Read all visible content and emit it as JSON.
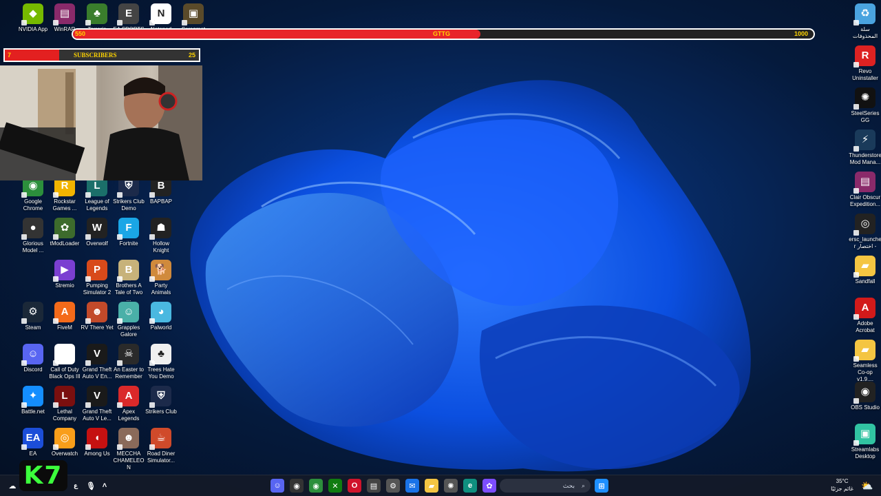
{
  "overlay": {
    "goal": {
      "left": "550",
      "center": "GTTG",
      "right": "1000",
      "fill_fraction": 0.55
    },
    "subs": {
      "left": "7",
      "label": "SUBSCRIBERS",
      "right": "25",
      "fill_fraction": 0.28
    },
    "logo_text": "K7"
  },
  "desktop_left": [
    {
      "label": "NVIDIA App",
      "icon": "nvidia-icon",
      "color": "#76b900",
      "glyph": "◆"
    },
    {
      "label": "WinRAR",
      "icon": "winrar-icon",
      "color": "#8a2a6a",
      "glyph": "▤"
    },
    {
      "label": "Terraria",
      "icon": "terraria-icon",
      "color": "#3a7d2c",
      "glyph": "♣"
    },
    {
      "label": "EA SPORTS",
      "icon": "ea-sports-icon",
      "color": "#444",
      "glyph": "E"
    },
    {
      "label": "Notepad",
      "icon": "notion-icon",
      "color": "#ffffff",
      "glyph": "N"
    },
    {
      "label": "Scrapmat",
      "icon": "scrap-icon",
      "color": "#5a4a2a",
      "glyph": "▣"
    },
    {
      "label": "Google Chrome",
      "icon": "chrome-icon",
      "color": "#2c8f3c",
      "glyph": "◉"
    },
    {
      "label": "Rockstar Games ...",
      "icon": "rockstar-icon",
      "color": "#f2b400",
      "glyph": "R"
    },
    {
      "label": "League of Legends",
      "icon": "league-icon",
      "color": "#1b6f6a",
      "glyph": "L"
    },
    {
      "label": "Strikers Club Demo",
      "icon": "strikers-icon",
      "color": "#1c2a4a",
      "glyph": "⛨"
    },
    {
      "label": "BAPBAP",
      "icon": "bapbap-icon",
      "color": "#222",
      "glyph": "B"
    },
    {
      "label": "Glorious Model ...",
      "icon": "mouse-icon",
      "color": "#333",
      "glyph": "●"
    },
    {
      "label": "tModLoader",
      "icon": "tmodloader-icon",
      "color": "#3d6b2c",
      "glyph": "✿"
    },
    {
      "label": "Overwolf",
      "icon": "overwolf-icon",
      "color": "#222",
      "glyph": "W"
    },
    {
      "label": "Fortnite",
      "icon": "fortnite-icon",
      "color": "#1aa6e6",
      "glyph": "F"
    },
    {
      "label": "Hollow Knight",
      "icon": "hollow-knight-icon",
      "color": "#222",
      "glyph": "☗"
    },
    {
      "label": "Stremio",
      "icon": "stremio-icon",
      "color": "#7b3fd1",
      "glyph": "▶"
    },
    {
      "label": "Pumping Simulator 2",
      "icon": "pumping-icon",
      "color": "#d84a1a",
      "glyph": "P"
    },
    {
      "label": "Brothers A Tale of Two ...",
      "icon": "brothers-icon",
      "color": "#c7b27a",
      "glyph": "B"
    },
    {
      "label": "Party Animals",
      "icon": "party-animals-icon",
      "color": "#d08a3c",
      "glyph": "🐕"
    },
    {
      "label": "Steam",
      "icon": "steam-icon",
      "color": "#1b2838",
      "glyph": "⚙"
    },
    {
      "label": "FiveM",
      "icon": "fivem-icon",
      "color": "#f46a1a",
      "glyph": "A"
    },
    {
      "label": "RV There Yet",
      "icon": "rv-icon",
      "color": "#c24a2a",
      "glyph": "☻"
    },
    {
      "label": "Grapples Galore",
      "icon": "grapples-icon",
      "color": "#4ab0a8",
      "glyph": "☺"
    },
    {
      "label": "Palworld",
      "icon": "palworld-icon",
      "color": "#4ab8e0",
      "glyph": "◕"
    },
    {
      "label": "Discord",
      "icon": "discord-icon",
      "color": "#5865f2",
      "glyph": "☺"
    },
    {
      "label": "Call of Duty Black Ops III",
      "icon": "file-icon",
      "color": "#ffffff",
      "glyph": " "
    },
    {
      "label": "Grand Theft Auto V En...",
      "icon": "gta-icon",
      "color": "#1a1a1a",
      "glyph": "V"
    },
    {
      "label": "An Easter to Remember",
      "icon": "easter-icon",
      "color": "#2a2a2a",
      "glyph": "☠"
    },
    {
      "label": "Trees Hate You Demo",
      "icon": "trees-icon",
      "color": "#f0f0f0",
      "glyph": "♣"
    },
    {
      "label": "Battle.net",
      "icon": "battlenet-icon",
      "color": "#148eff",
      "glyph": "✦"
    },
    {
      "label": "Lethal Company",
      "icon": "lethal-icon",
      "color": "#7a0f0f",
      "glyph": "L"
    },
    {
      "label": "Grand Theft Auto V Le...",
      "icon": "gta-icon",
      "color": "#1a1a1a",
      "glyph": "V"
    },
    {
      "label": "Apex Legends",
      "icon": "apex-icon",
      "color": "#da292a",
      "glyph": "A"
    },
    {
      "label": "Strikers Club",
      "icon": "strikers-icon",
      "color": "#1c2a4a",
      "glyph": "⛨"
    },
    {
      "label": "EA",
      "icon": "ea-icon",
      "color": "#1c4ed8",
      "glyph": "EA"
    },
    {
      "label": "Overwatch",
      "icon": "overwatch-icon",
      "color": "#f99e1a",
      "glyph": "◎"
    },
    {
      "label": "Among Us",
      "icon": "among-us-icon",
      "color": "#c51111",
      "glyph": "◖"
    },
    {
      "label": "MECCHA CHAMELEON",
      "icon": "meccha-icon",
      "color": "#8a6a5a",
      "glyph": "☻"
    },
    {
      "label": "Road Diner Simulator...",
      "icon": "road-diner-icon",
      "color": "#d04a2a",
      "glyph": "☕"
    }
  ],
  "desktop_right": [
    {
      "label": "سلة المحذوفات",
      "icon": "recycle-bin-icon",
      "color": "#4aa3df",
      "glyph": "♻"
    },
    {
      "label": "Revo Uninstaller",
      "icon": "revo-icon",
      "color": "#d22",
      "glyph": "R"
    },
    {
      "label": "SteelSeries GG",
      "icon": "steelseries-icon",
      "color": "#111",
      "glyph": "✺"
    },
    {
      "label": "Thunderstore Mod Mana...",
      "icon": "thunderstore-icon",
      "color": "#1a3a5a",
      "glyph": "⚡"
    },
    {
      "label": "Clair Obscur Expedition...",
      "icon": "winrar-icon",
      "color": "#8a2a6a",
      "glyph": "▤"
    },
    {
      "label": "ersc_launcher اختصار -",
      "icon": "ersc-icon",
      "color": "#222",
      "glyph": "◎"
    },
    {
      "label": "Sandfall",
      "icon": "folder-icon",
      "color": "#f4c542",
      "glyph": "▰"
    },
    {
      "label": "Adobe Acrobat",
      "icon": "acrobat-icon",
      "color": "#d21a1a",
      "glyph": "A"
    },
    {
      "label": "Seamless Co-op v1.9....",
      "icon": "folder-icon",
      "color": "#f4c542",
      "glyph": "▰"
    },
    {
      "label": "OBS Studio",
      "icon": "obs-icon",
      "color": "#222",
      "glyph": "◉"
    },
    {
      "label": "Streamlabs Desktop",
      "icon": "streamlabs-icon",
      "color": "#31c3a2",
      "glyph": "▣"
    }
  ],
  "taskbar": {
    "search_text": "بحث",
    "weather": "35°C",
    "weather_desc": "غائم جزئيًا",
    "apps": [
      {
        "icon": "discord-icon",
        "color": "#5865f2",
        "glyph": "☺"
      },
      {
        "icon": "obs-icon",
        "color": "#333",
        "glyph": "◉"
      },
      {
        "icon": "chrome-icon",
        "color": "#2c8f3c",
        "glyph": "◉"
      },
      {
        "icon": "xbox-icon",
        "color": "#107c10",
        "glyph": "✕"
      },
      {
        "icon": "opera-icon",
        "color": "#d0132b",
        "glyph": "O"
      },
      {
        "icon": "notepad-icon",
        "color": "#444",
        "glyph": "▤"
      },
      {
        "icon": "settings-icon",
        "color": "#555",
        "glyph": "⚙"
      },
      {
        "icon": "mail-icon",
        "color": "#1a73e8",
        "glyph": "✉"
      },
      {
        "icon": "file-explorer-icon",
        "color": "#f4c542",
        "glyph": "▰"
      },
      {
        "icon": "steelseries-icon",
        "color": "#555",
        "glyph": "✺"
      },
      {
        "icon": "edge-icon",
        "color": "#0f8f7f",
        "glyph": "e"
      },
      {
        "icon": "copilot-icon",
        "color": "#7c4dff",
        "glyph": "✿"
      }
    ]
  }
}
